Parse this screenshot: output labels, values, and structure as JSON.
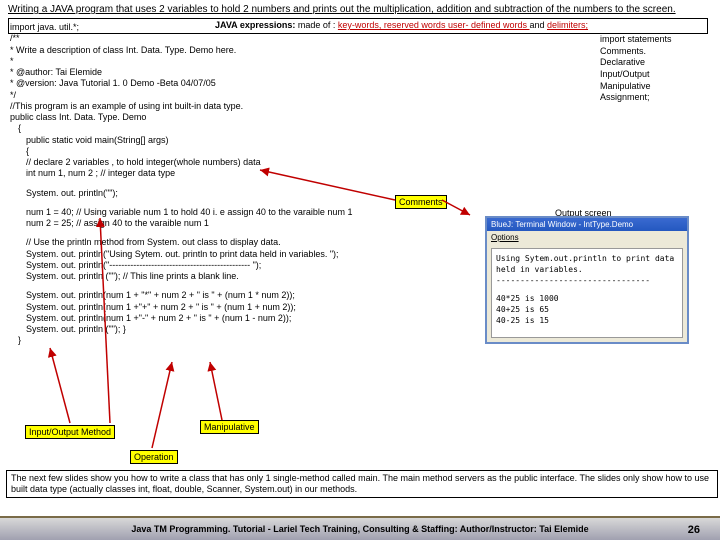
{
  "title": "Writing a JAVA program that uses 2 variables to hold 2 numbers and prints out the multiplication, addition and subtraction of the numbers to the screen.",
  "jexpr": {
    "lead": "JAVA expressions:",
    "made": " made of : ",
    "k1": "key-words, reserved words user- defined words ",
    "and": "and ",
    "k2": "delimiters;"
  },
  "side": {
    "import": "import statements",
    "comments": "Comments.",
    "decl": "Declarative",
    "io": "Input/Output",
    "manip": "Manipulative",
    "assign": "Assignment;"
  },
  "code": {
    "l1": "import java. util.*;",
    "l2": "/**",
    "l3": "* Write a description of class Int. Data. Type. Demo here.",
    "l4": "*",
    "l5": "* @author: Tai Elemide",
    "l6": "* @version: Java Tutorial 1. 0 Demo -Beta 04/07/05",
    "l7": "*/",
    "l8": "//This program is an example of using int built-in data type.",
    "l9": "public class Int. Data. Type. Demo",
    "l10": "{",
    "l11": "public static void main(String[] args)",
    "l12": "{",
    "l13": "// declare 2 variables , to hold integer(whole numbers) data",
    "l14": " int num 1, num 2 ;  // integer data type",
    "l15": "System. out. println(\"\");",
    "l16": "num 1 = 40;  // Using variable num 1 to hold 40 i. e assign 40 to the varaible num 1",
    "l17": "num 2 = 25;  // assign 40 to the varaible num 1",
    "l18": "// Use the println method from System. out class to display data.",
    "l19": "System. out. println(\"Using Sytem. out. println to print data held in variables. \");",
    "l20": "System. out. println(\"----------------------------------------------- \");",
    "l21": "System. out. println (\"\");  // This line prints a blank line.",
    "l22": "System. out. println(num 1 + \"*\" + num 2 + \" is \" + (num 1 * num 2));",
    "l23": "System. out. println(num 1 +\"+\" + num 2 + \" is \" + (num 1 + num 2));",
    "l24": "System. out. println(num 1 +\"-\" + num 2 + \" is \" + (num 1 - num 2));",
    "l25": "System. out. println (\"\"); }",
    "l26": "}"
  },
  "labels": {
    "comments": "Comments",
    "output": "Output screen",
    "iomethod": "Input/Output Method",
    "manip": "Manipulative",
    "op": "Operation"
  },
  "bottom": "The next few slides show you how to write a class that has only 1 single-method called main. The main method servers as the public interface. The slides only show how to use built data type (actually classes int, float, double, Scanner, System.out) in our methods.",
  "footer": "Java TM Programming. Tutorial - Lariel Tech Training, Consulting & Staffing: Author/Instructor: Tai Elemide",
  "page": "26",
  "term": {
    "title": "BlueJ: Terminal Window - IntType.Demo",
    "opts": "Options",
    "l1": "Using Sytem.out.println to print data held in variables.",
    "l2": "--------------------------------",
    "l3": "40*25 is 1000",
    "l4": "40+25 is 65",
    "l5": "40-25 is 15"
  }
}
